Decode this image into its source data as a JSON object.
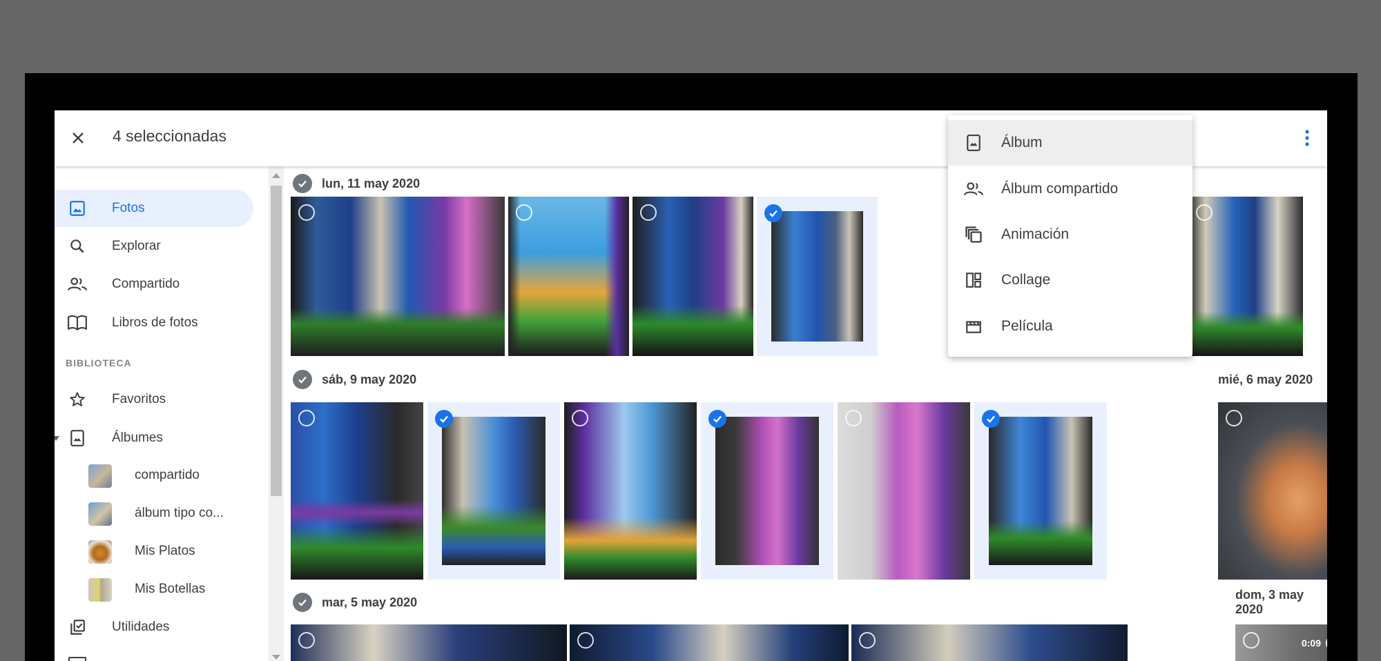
{
  "header": {
    "selection_count": "4 seleccionadas",
    "icons": [
      "close-icon",
      "add-icon",
      "shopping-bag-icon",
      "trash-icon",
      "more-vert-icon"
    ],
    "accent": "#1a73e8"
  },
  "sidebar": {
    "items": [
      {
        "label": "Fotos",
        "icon": "photo-icon",
        "active": true
      },
      {
        "label": "Explorar",
        "icon": "search-icon"
      },
      {
        "label": "Compartido",
        "icon": "people-icon"
      },
      {
        "label": "Libros de fotos",
        "icon": "book-icon"
      }
    ],
    "section_label": "BIBLIOTECA",
    "library": [
      {
        "label": "Favoritos",
        "icon": "star-icon"
      },
      {
        "label": "Álbumes",
        "icon": "album-icon"
      }
    ],
    "albums": [
      {
        "label": "compartido"
      },
      {
        "label": "álbum tipo co..."
      },
      {
        "label": "Mis Platos"
      },
      {
        "label": "Mis Botellas"
      }
    ],
    "utilities": {
      "label": "Utilidades",
      "icon": "checklist-icon"
    }
  },
  "main": {
    "dates": {
      "d1": "lun, 11 may 2020",
      "d2": "sáb, 9 may 2020",
      "d3": "mié, 6 may 2020",
      "d4": "mar, 5 may 2020",
      "d5": "dom, 3 may 2020"
    },
    "video_duration": "0:09"
  },
  "create_menu": {
    "items": [
      {
        "label": "Álbum",
        "icon": "album-icon"
      },
      {
        "label": "Álbum compartido",
        "icon": "shared-album-icon"
      },
      {
        "label": "Animación",
        "icon": "animation-icon"
      },
      {
        "label": "Collage",
        "icon": "collage-icon"
      },
      {
        "label": "Película",
        "icon": "movie-icon"
      }
    ]
  }
}
